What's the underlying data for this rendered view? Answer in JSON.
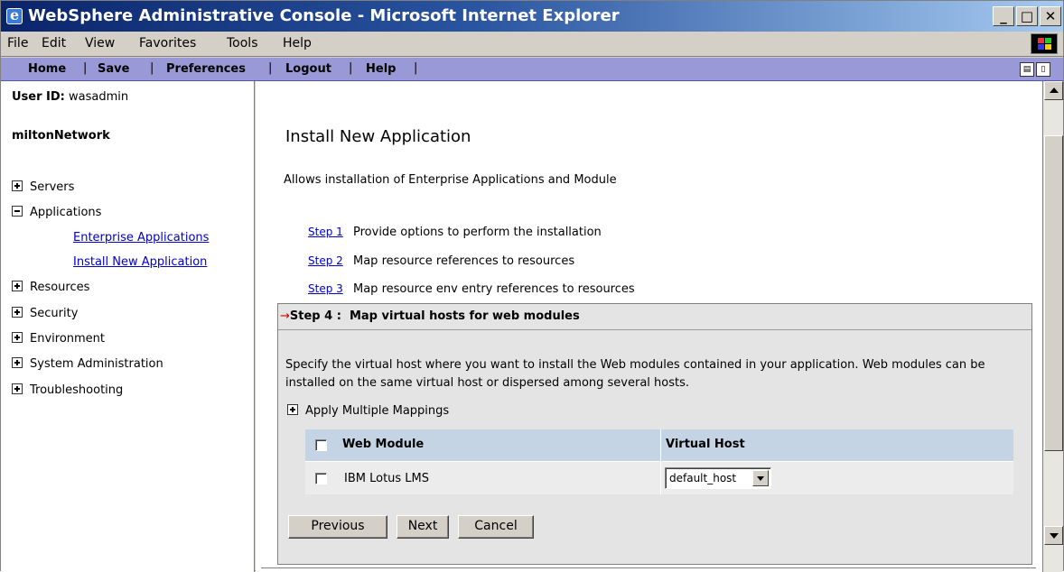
{
  "window": {
    "title": "WebSphere Administrative Console - Microsoft Internet Explorer",
    "minimize_glyph": "_",
    "maximize_glyph": "□",
    "close_glyph": "✕"
  },
  "menu": [
    {
      "label": "File"
    },
    {
      "label": "Edit"
    },
    {
      "label": "View"
    },
    {
      "label": "Favorites"
    },
    {
      "label": "Tools"
    },
    {
      "label": "Help"
    }
  ],
  "nav": {
    "home": "Home",
    "save": "Save",
    "preferences": "Preferences",
    "logout": "Logout",
    "help": "Help",
    "separator": "|"
  },
  "sidebar": {
    "user_label": "User ID:",
    "user_value": "wasadmin",
    "network": "miltonNetwork",
    "items": [
      {
        "label": "Servers",
        "expanded": false
      },
      {
        "label": "Applications",
        "expanded": true
      },
      {
        "label": "Resources",
        "expanded": false
      },
      {
        "label": "Security",
        "expanded": false
      },
      {
        "label": "Environment",
        "expanded": false
      },
      {
        "label": "System Administration",
        "expanded": false
      },
      {
        "label": "Troubleshooting",
        "expanded": false
      }
    ],
    "app_links": [
      "Enterprise Applications",
      "Install New Application"
    ]
  },
  "main": {
    "title": "Install New Application",
    "description": "Allows installation of Enterprise Applications and Module",
    "steps": [
      {
        "link": "Step 1",
        "text": "Provide options to perform the installation"
      },
      {
        "link": "Step 2",
        "text": "Map resource references to resources"
      },
      {
        "link": "Step 3",
        "text": "Map resource env entry references to resources"
      }
    ],
    "current_step": {
      "arrow": "→",
      "label": "Step 4 :",
      "title": "Map virtual hosts for web modules",
      "description": "Specify the virtual host where you want to install the Web modules contained in your application. Web modules can be installed on the same virtual host or dispersed among several hosts.",
      "apply_multiple": "Apply Multiple Mappings"
    },
    "table": {
      "headers": [
        "Web Module",
        "Virtual Host"
      ],
      "rows": [
        {
          "web_module": "IBM Lotus LMS",
          "virtual_host": "default_host"
        }
      ]
    },
    "buttons": {
      "previous": "Previous",
      "next": "Next",
      "cancel": "Cancel"
    }
  }
}
